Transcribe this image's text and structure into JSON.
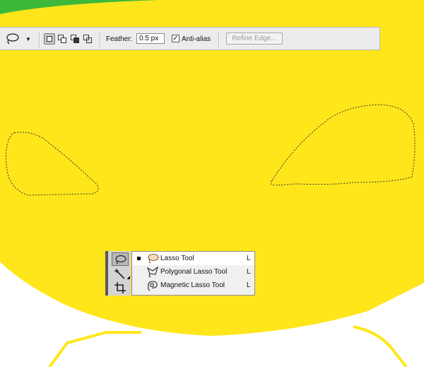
{
  "options_bar": {
    "feather_label": "Feather:",
    "feather_value": "0.5 px",
    "antialias_label": "Anti-alias",
    "antialias_checked": true,
    "refine_edge_label": "Refine Edge..."
  },
  "flyout": {
    "items": [
      {
        "label": "Lasso Tool",
        "shortcut": "L",
        "icon": "lasso-icon",
        "selected": true
      },
      {
        "label": "Polygonal Lasso Tool",
        "shortcut": "L",
        "icon": "polygonal-lasso-icon",
        "selected": false
      },
      {
        "label": "Magnetic Lasso Tool",
        "shortcut": "L",
        "icon": "magnetic-lasso-icon",
        "selected": false
      }
    ]
  },
  "tool_strip": {
    "tools": [
      "lasso-icon",
      "magic-wand-icon",
      "crop-icon"
    ]
  },
  "colors": {
    "canvas_yellow": "#ffe61a",
    "canvas_green": "#3cb93a",
    "canvas_white": "#ffffff"
  }
}
